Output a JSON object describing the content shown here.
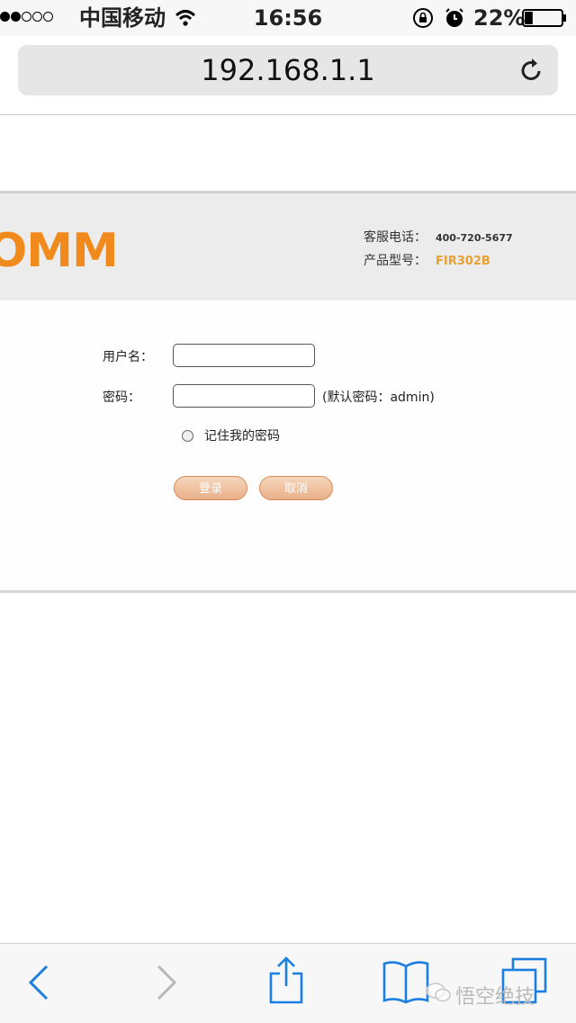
{
  "status_bar": {
    "signal_bars": [
      true,
      true,
      false,
      false,
      false
    ],
    "carrier": "中国移动",
    "time": "16:56",
    "battery_percent": "22%",
    "battery_level": 0.22
  },
  "address_bar": {
    "url": "192.168.1.1"
  },
  "router_header": {
    "logo_text": "OMM",
    "service_phone_label": "客服电话：",
    "service_phone": "400-720-5677",
    "model_label": "产品型号：",
    "model": "FIR302B",
    "accent_color": "#f08a1c"
  },
  "login_form": {
    "username_label": "用户名：",
    "username_value": "",
    "password_label": "密码：",
    "password_value": "",
    "password_hint": "(默认密码：admin)",
    "remember_label": "记住我的密码",
    "remember_checked": false,
    "login_button": "登录",
    "cancel_button": "取消"
  },
  "toolbar": {
    "icons": [
      "back-icon",
      "forward-icon",
      "share-icon",
      "bookmarks-icon",
      "tabs-icon"
    ],
    "tint_color": "#1a7fe0"
  },
  "watermark": {
    "text": "悟空绝技"
  }
}
